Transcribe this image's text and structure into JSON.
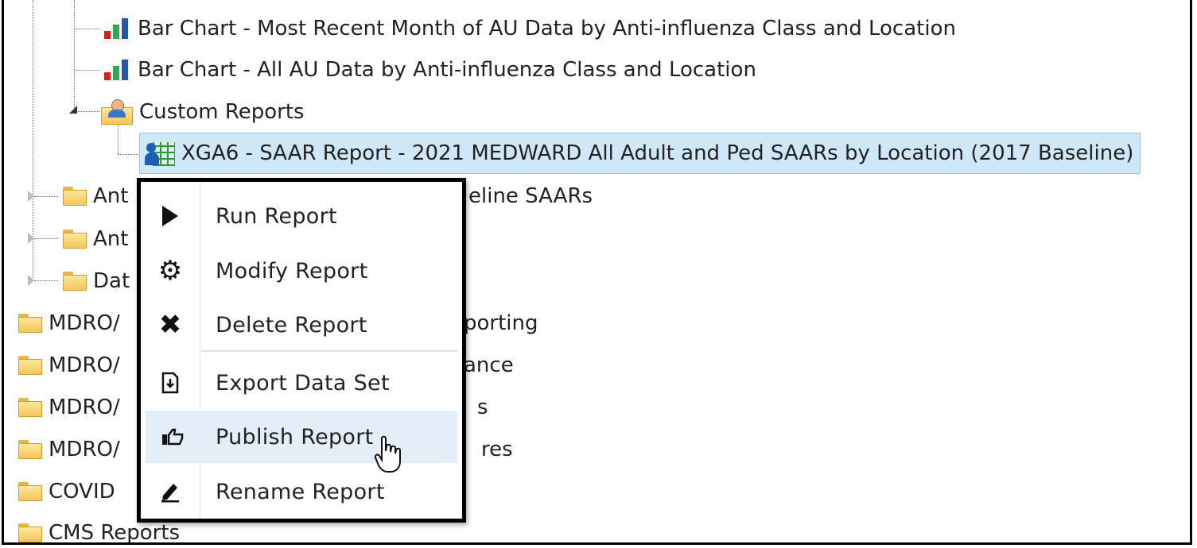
{
  "tree": {
    "nodes": [
      {
        "label": "Bar Chart - Most Recent Month of AU Data by Anti-influenza Class and Location",
        "icon": "bar-chart-icon"
      },
      {
        "label": "Bar Chart - All AU Data by Anti-influenza Class and Location",
        "icon": "bar-chart-icon"
      },
      {
        "label": "Custom Reports",
        "icon": "custom-reports-folder-icon"
      },
      {
        "label": "XGA6 - SAAR Report - 2021 MEDWARD All Adult and Ped SAARs by Location (2017 Baseline)",
        "icon": "report-grid-icon",
        "selected": true
      },
      {
        "label": "Ant",
        "suffix": "eline SAARs",
        "icon": "folder-icon"
      },
      {
        "label": "Ant",
        "icon": "folder-icon"
      },
      {
        "label": "Dat",
        "icon": "folder-icon"
      },
      {
        "label": "MDRO/",
        "suffix": "porting",
        "icon": "folder-icon"
      },
      {
        "label": "MDRO/",
        "suffix": "ance",
        "icon": "folder-icon"
      },
      {
        "label": "MDRO/",
        "suffix": "s",
        "icon": "folder-icon"
      },
      {
        "label": "MDRO/",
        "suffix": "res",
        "icon": "folder-icon"
      },
      {
        "label": "COVID",
        "icon": "folder-icon"
      },
      {
        "label": "CMS Reports",
        "icon": "folder-icon"
      }
    ]
  },
  "context_menu": {
    "items": [
      {
        "label": "Run Report",
        "icon": "play-icon"
      },
      {
        "label": "Modify Report",
        "icon": "gear-icon"
      },
      {
        "label": "Delete Report",
        "icon": "close-icon"
      },
      {
        "label": "Export Data Set",
        "icon": "export-icon"
      },
      {
        "label": "Publish Report",
        "icon": "thumbs-up-icon",
        "hovered": true
      },
      {
        "label": "Rename Report",
        "icon": "pencil-icon"
      }
    ]
  },
  "colors": {
    "selection_bg": "#cfe8f8",
    "hover_bg": "#e4eef8",
    "folder": "#f3c75a"
  }
}
